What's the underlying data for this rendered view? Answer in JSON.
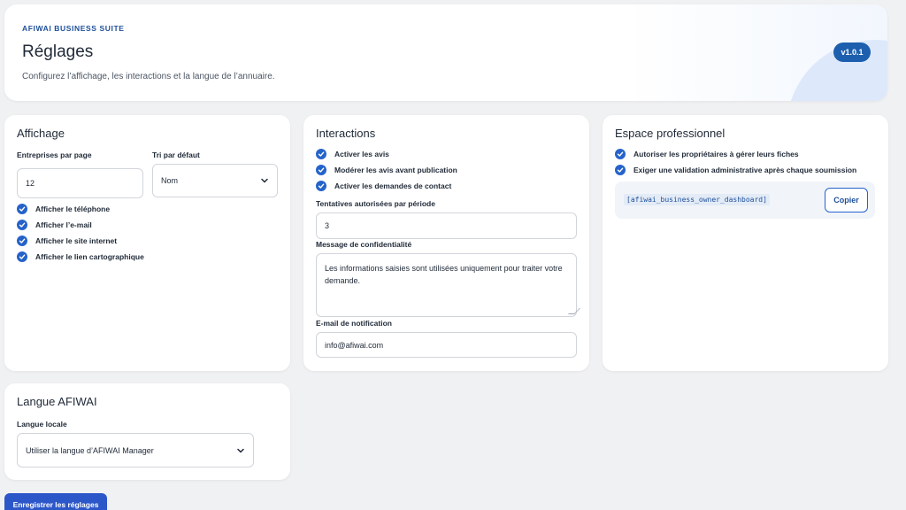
{
  "header": {
    "brand": "AFIWAI BUSINESS SUITE",
    "title": "Réglages",
    "subtitle": "Configurez l’affichage, les interactions et la langue de l’annuaire.",
    "version": "v1.0.1"
  },
  "display": {
    "title": "Affichage",
    "per_page_label": "Entreprises par page",
    "per_page_value": "12",
    "sort_label": "Tri par défaut",
    "sort_value": "Nom",
    "checks": [
      {
        "label": "Afficher le téléphone",
        "checked": true
      },
      {
        "label": "Afficher l’e-mail",
        "checked": true
      },
      {
        "label": "Afficher le site internet",
        "checked": true
      },
      {
        "label": "Afficher le lien cartographique",
        "checked": true
      }
    ]
  },
  "interactions": {
    "title": "Interactions",
    "checks": [
      {
        "label": "Activer les avis",
        "checked": true
      },
      {
        "label": "Modérer les avis avant publication",
        "checked": true
      },
      {
        "label": "Activer les demandes de contact",
        "checked": true
      }
    ],
    "attempts_label": "Tentatives autorisées par période",
    "attempts_value": "3",
    "privacy_label": "Message de confidentialité",
    "privacy_value": "Les informations saisies sont utilisées uniquement pour traiter votre demande.",
    "email_label": "E-mail de notification",
    "email_value": "info@afiwai.com"
  },
  "pro": {
    "title": "Espace professionnel",
    "checks": [
      {
        "label": "Autoriser les propriétaires à gérer leurs fiches",
        "checked": true
      },
      {
        "label": "Exiger une validation administrative après chaque soumission",
        "checked": true
      }
    ],
    "shortcode": "[afiwai_business_owner_dashboard]",
    "copy_label": "Copier"
  },
  "language": {
    "title": "Langue AFIWAI",
    "locale_label": "Langue locale",
    "locale_value": "Utiliser la langue d’AFIWAI Manager"
  },
  "save_label": "Enregistrer les réglages",
  "colors": {
    "accent": "#2563c9",
    "brand": "#1d4f9a",
    "version_badge": "#1d5fae",
    "save_button": "#2c57c9",
    "background": "#f0f1f3"
  }
}
